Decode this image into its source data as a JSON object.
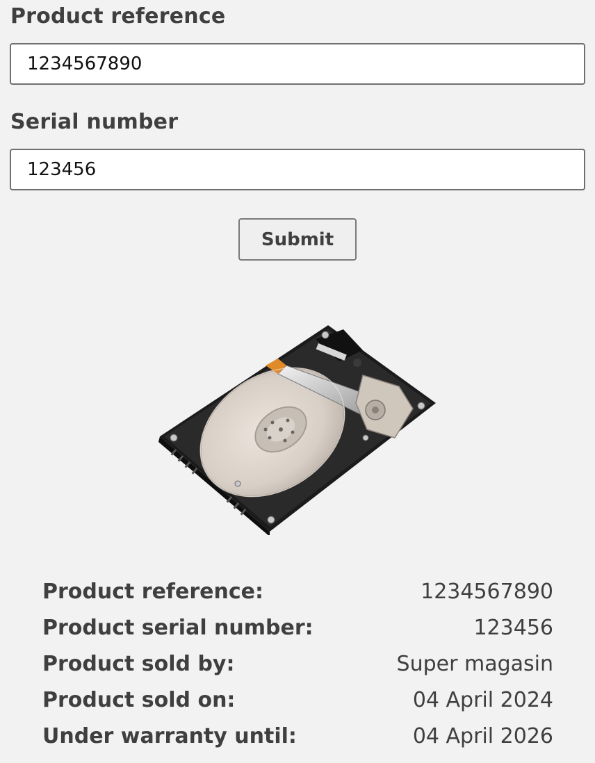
{
  "form": {
    "product_reference_label": "Product reference",
    "product_reference_value": "1234567890",
    "serial_number_label": "Serial number",
    "serial_number_value": "123456",
    "submit_label": "Submit"
  },
  "product_image": {
    "icon": "hard-drive-image"
  },
  "details": [
    {
      "label": "Product reference:",
      "value": "1234567890"
    },
    {
      "label": "Product serial number:",
      "value": "123456"
    },
    {
      "label": "Product sold by:",
      "value": "Super magasin"
    },
    {
      "label": "Product sold on:",
      "value": "04 April 2024"
    },
    {
      "label": "Under warranty until:",
      "value": "04 April 2026"
    }
  ]
}
